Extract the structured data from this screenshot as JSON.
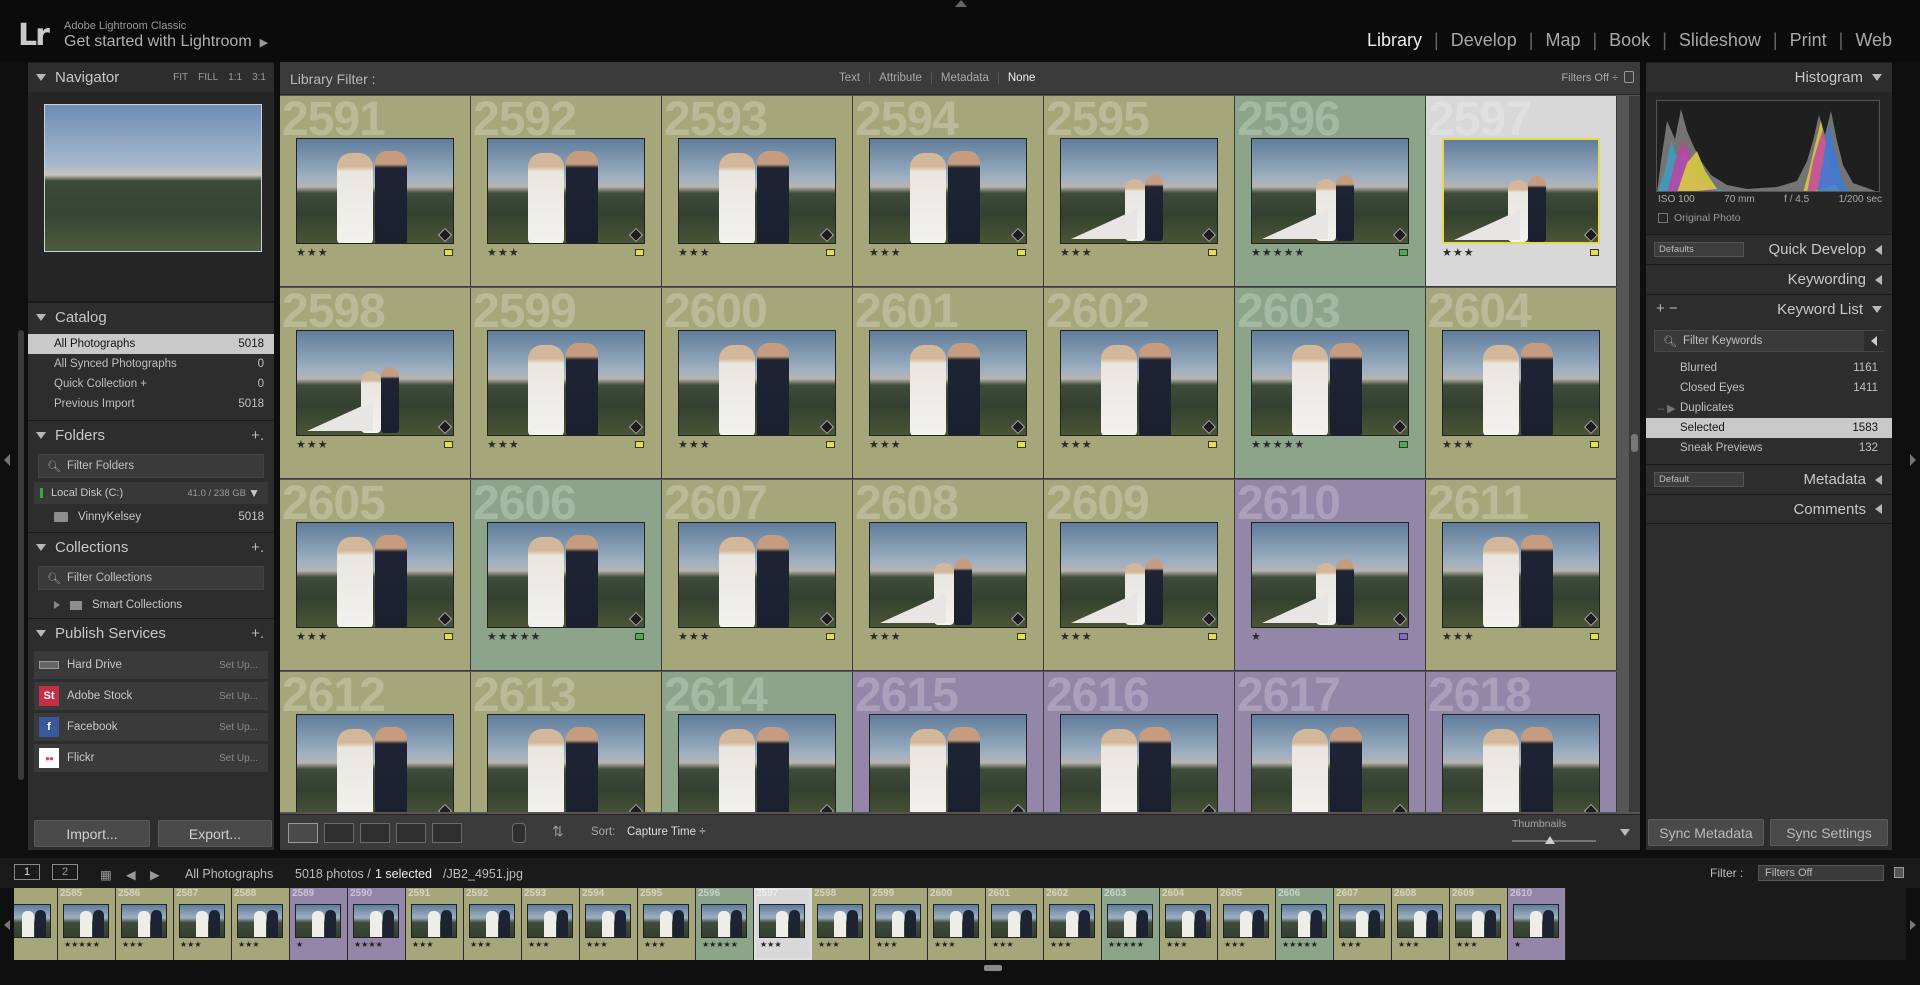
{
  "app": {
    "logo": "Lr",
    "name": "Adobe Lightroom Classic",
    "subtitle": "Get started with Lightroom",
    "subtitle_arrow": "▶"
  },
  "modules": [
    {
      "label": "Library",
      "active": true
    },
    {
      "label": "Develop",
      "active": false
    },
    {
      "label": "Map",
      "active": false
    },
    {
      "label": "Book",
      "active": false
    },
    {
      "label": "Slideshow",
      "active": false
    },
    {
      "label": "Print",
      "active": false
    },
    {
      "label": "Web",
      "active": false
    }
  ],
  "navigator": {
    "title": "Navigator",
    "zoom": [
      "FIT",
      "FILL",
      "1:1",
      "3:1"
    ]
  },
  "catalog": {
    "title": "Catalog",
    "items": [
      {
        "label": "All Photographs",
        "count": "5018",
        "selected": true
      },
      {
        "label": "All Synced Photographs",
        "count": "0",
        "selected": false
      },
      {
        "label": "Quick Collection  +",
        "count": "0",
        "selected": false
      },
      {
        "label": "Previous Import",
        "count": "5018",
        "selected": false
      }
    ]
  },
  "folders": {
    "title": "Folders",
    "filter_placeholder": "Filter Folders",
    "disk": {
      "label": "Local Disk (C:)",
      "capacity": "41.0 / 238 GB"
    },
    "items": [
      {
        "label": "VinnyKelsey",
        "count": "5018"
      }
    ]
  },
  "collections": {
    "title": "Collections",
    "filter_placeholder": "Filter Collections",
    "items": [
      {
        "label": "Smart Collections"
      }
    ]
  },
  "publish": {
    "title": "Publish Services",
    "setup": "Set Up...",
    "items": [
      {
        "label": "Hard Drive",
        "icon": "hard-drive-icon",
        "color": "#777777",
        "glyph": ""
      },
      {
        "label": "Adobe Stock",
        "icon": "adobe-stock-icon",
        "color": "#c62d49",
        "glyph": "St"
      },
      {
        "label": "Facebook",
        "icon": "facebook-icon",
        "color": "#3b5998",
        "glyph": "f"
      },
      {
        "label": "Flickr",
        "icon": "flickr-icon",
        "color": "#ffffff",
        "glyph": "●●"
      }
    ]
  },
  "left_buttons": {
    "import": "Import...",
    "export": "Export..."
  },
  "library_filter": {
    "title": "Library Filter :",
    "tabs": [
      {
        "label": "Text",
        "on": false
      },
      {
        "label": "Attribute",
        "on": false
      },
      {
        "label": "Metadata",
        "on": false
      },
      {
        "label": "None",
        "on": true
      }
    ],
    "preset": "Filters Off ÷"
  },
  "grid": {
    "colors": {
      "yellow": "#a5a77b",
      "green": "#8ba48a",
      "purple": "#9486a8",
      "white": "#d8d8d8"
    },
    "label_colors": {
      "yellow": "#e6e23c",
      "green": "#46b04e",
      "purple": "#8a63c8"
    },
    "cells": [
      {
        "num": "2591",
        "stars": "★★★",
        "label": "yellow",
        "pose": "close"
      },
      {
        "num": "2592",
        "stars": "★★★",
        "label": "yellow",
        "pose": "close"
      },
      {
        "num": "2593",
        "stars": "★★★",
        "label": "yellow",
        "pose": "close"
      },
      {
        "num": "2594",
        "stars": "★★★",
        "label": "yellow",
        "pose": "close"
      },
      {
        "num": "2595",
        "stars": "★★★",
        "label": "yellow",
        "pose": "wide"
      },
      {
        "num": "2596",
        "stars": "★★★★★",
        "label": "green",
        "pose": "wide"
      },
      {
        "num": "2597",
        "stars": "★★★",
        "label": "yellow",
        "pose": "wide",
        "selected": true
      },
      {
        "num": "2598",
        "stars": "★★★",
        "label": "yellow",
        "pose": "wide"
      },
      {
        "num": "2599",
        "stars": "★★★",
        "label": "yellow",
        "pose": "close"
      },
      {
        "num": "2600",
        "stars": "★★★",
        "label": "yellow",
        "pose": "close"
      },
      {
        "num": "2601",
        "stars": "★★★",
        "label": "yellow",
        "pose": "close"
      },
      {
        "num": "2602",
        "stars": "★★★",
        "label": "yellow",
        "pose": "close"
      },
      {
        "num": "2603",
        "stars": "★★★★★",
        "label": "green",
        "pose": "close"
      },
      {
        "num": "2604",
        "stars": "★★★",
        "label": "yellow",
        "pose": "close"
      },
      {
        "num": "2605",
        "stars": "★★★",
        "label": "yellow",
        "pose": "close"
      },
      {
        "num": "2606",
        "stars": "★★★★★",
        "label": "green",
        "pose": "close"
      },
      {
        "num": "2607",
        "stars": "★★★",
        "label": "yellow",
        "pose": "close"
      },
      {
        "num": "2608",
        "stars": "★★★",
        "label": "yellow",
        "pose": "wide"
      },
      {
        "num": "2609",
        "stars": "★★★",
        "label": "yellow",
        "pose": "wide"
      },
      {
        "num": "2610",
        "stars": "★",
        "label": "purple",
        "pose": "wide"
      },
      {
        "num": "2611",
        "stars": "★★★",
        "label": "yellow",
        "pose": "close"
      },
      {
        "num": "2612",
        "stars": "",
        "label": "yellow",
        "pose": "close"
      },
      {
        "num": "2613",
        "stars": "",
        "label": "yellow",
        "pose": "close"
      },
      {
        "num": "2614",
        "stars": "",
        "label": "green",
        "pose": "close"
      },
      {
        "num": "2615",
        "stars": "",
        "label": "purple",
        "pose": "close"
      },
      {
        "num": "2616",
        "stars": "",
        "label": "purple",
        "pose": "close"
      },
      {
        "num": "2617",
        "stars": "",
        "label": "purple",
        "pose": "close"
      },
      {
        "num": "2618",
        "stars": "",
        "label": "purple",
        "pose": "close"
      }
    ]
  },
  "toolbar": {
    "sort_label": "Sort:",
    "sort_value": "Capture Time ÷",
    "thumbnails_label": "Thumbnails",
    "thumbnail_size": 0.45
  },
  "histogram": {
    "title": "Histogram",
    "iso": "ISO 100",
    "focal": "70 mm",
    "aperture": "f / 4.5",
    "shutter": "1/200 sec",
    "original_photo": "Original Photo"
  },
  "right_panels": {
    "quick_develop": {
      "title": "Quick Develop",
      "preset": "Defaults"
    },
    "keywording": {
      "title": "Keywording"
    },
    "keyword_list": {
      "title": "Keyword List",
      "filter_placeholder": "Filter Keywords",
      "items": [
        {
          "label": "Blurred",
          "count": "1161",
          "mark": "",
          "selected": false
        },
        {
          "label": "Closed Eyes",
          "count": "1411",
          "mark": "",
          "selected": false
        },
        {
          "label": "Duplicates",
          "count": "",
          "mark": "‒ ▶",
          "selected": false
        },
        {
          "label": "Selected",
          "count": "1583",
          "mark": "",
          "selected": true
        },
        {
          "label": "Sneak Previews",
          "count": "132",
          "mark": "",
          "selected": false
        }
      ]
    },
    "metadata": {
      "title": "Metadata",
      "preset": "Default"
    },
    "comments": {
      "title": "Comments"
    }
  },
  "sync_buttons": {
    "metadata": "Sync Metadata",
    "settings": "Sync Settings"
  },
  "filmstrip_bar": {
    "page1": "1",
    "page2": "2",
    "source": "All Photographs",
    "count": "5018 photos /",
    "selected": "1 selected",
    "file": "/JB2_4951.jpg",
    "filter_label": "Filter :",
    "filter_value": "Filters Off"
  },
  "filmstrip": [
    {
      "num": "",
      "label": "yellow",
      "stars": ""
    },
    {
      "num": "2585",
      "label": "yellow",
      "stars": "★★★★★"
    },
    {
      "num": "2586",
      "label": "yellow",
      "stars": "★★★"
    },
    {
      "num": "2587",
      "label": "yellow",
      "stars": "★★★"
    },
    {
      "num": "2588",
      "label": "yellow",
      "stars": "★★★"
    },
    {
      "num": "2589",
      "label": "purple",
      "stars": "★"
    },
    {
      "num": "2590",
      "label": "purple",
      "stars": "★★★★"
    },
    {
      "num": "2591",
      "label": "yellow",
      "stars": "★★★"
    },
    {
      "num": "2592",
      "label": "yellow",
      "stars": "★★★"
    },
    {
      "num": "2593",
      "label": "yellow",
      "stars": "★★★"
    },
    {
      "num": "2594",
      "label": "yellow",
      "stars": "★★★"
    },
    {
      "num": "2595",
      "label": "yellow",
      "stars": "★★★"
    },
    {
      "num": "2596",
      "label": "green",
      "stars": "★★★★★"
    },
    {
      "num": "2597",
      "label": "white",
      "stars": "★★★",
      "selected": true
    },
    {
      "num": "2598",
      "label": "yellow",
      "stars": "★★★"
    },
    {
      "num": "2599",
      "label": "yellow",
      "stars": "★★★"
    },
    {
      "num": "2600",
      "label": "yellow",
      "stars": "★★★"
    },
    {
      "num": "2601",
      "label": "yellow",
      "stars": "★★★"
    },
    {
      "num": "2602",
      "label": "yellow",
      "stars": "★★★"
    },
    {
      "num": "2603",
      "label": "green",
      "stars": "★★★★★"
    },
    {
      "num": "2604",
      "label": "yellow",
      "stars": "★★★"
    },
    {
      "num": "2605",
      "label": "yellow",
      "stars": "★★★"
    },
    {
      "num": "2606",
      "label": "green",
      "stars": "★★★★★"
    },
    {
      "num": "2607",
      "label": "yellow",
      "stars": "★★★"
    },
    {
      "num": "2608",
      "label": "yellow",
      "stars": "★★★"
    },
    {
      "num": "2609",
      "label": "yellow",
      "stars": "★★★"
    },
    {
      "num": "2610",
      "label": "purple",
      "stars": "★"
    }
  ]
}
